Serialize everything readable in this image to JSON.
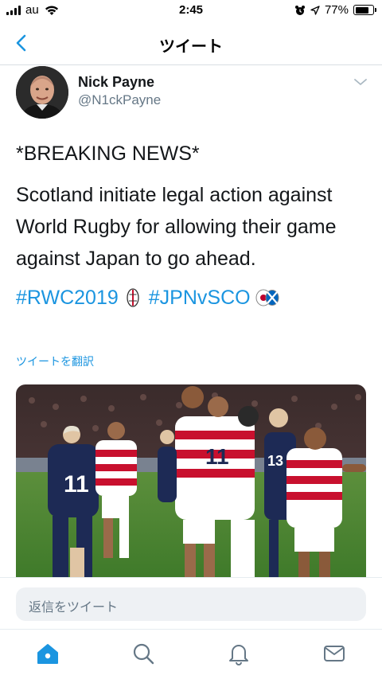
{
  "status_bar": {
    "carrier": "au",
    "time": "2:45",
    "battery": "77%",
    "battery_level": 0.77
  },
  "nav": {
    "title": "ツイート"
  },
  "tweet": {
    "name": "Nick Payne",
    "handle": "@N1ckPayne",
    "lines": [
      "*BREAKING NEWS*",
      "Scotland initiate legal action against",
      "World Rugby for allowing their game",
      "against Japan to go ahead."
    ],
    "hashtags": [
      "#RWC2019",
      "#JPNvSCO"
    ],
    "translate_label": "ツイートを翻訳"
  },
  "reply": {
    "placeholder": "返信をツイート"
  },
  "tabs": [
    "home-icon",
    "search-icon",
    "notifications-icon",
    "messages-icon"
  ],
  "colors": {
    "accent": "#1b95e0",
    "text": "#14171a",
    "secondary": "#657786"
  }
}
